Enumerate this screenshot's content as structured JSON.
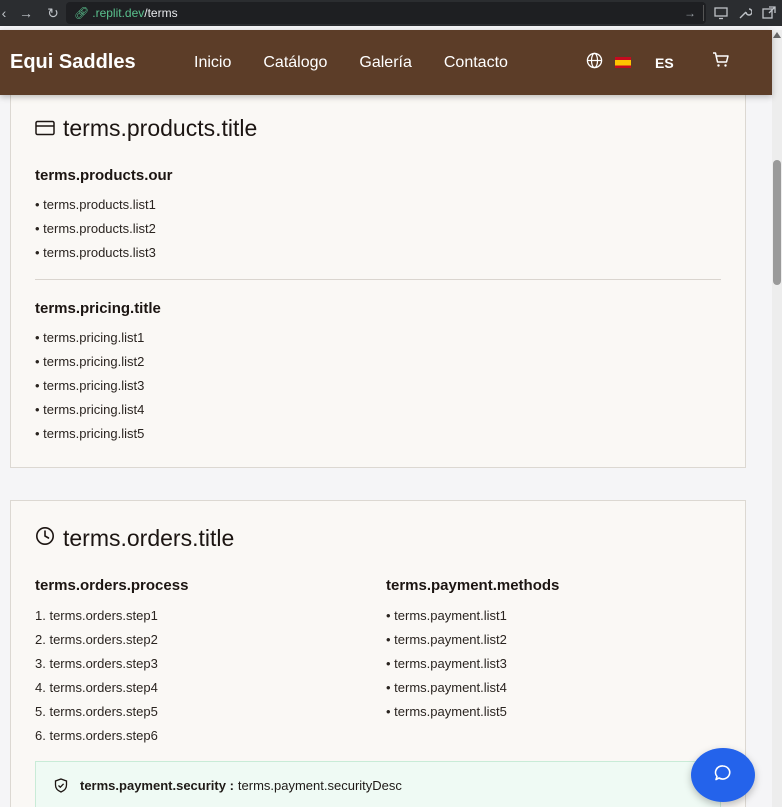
{
  "browser": {
    "url_host": ".replit.dev",
    "url_path": "/terms"
  },
  "header": {
    "brand": "Equi Saddles",
    "nav": [
      "Inicio",
      "Catálogo",
      "Galería",
      "Contacto"
    ],
    "lang_code": "ES",
    "icons": [
      "globe-icon",
      "spain-flag-icon",
      "cart-icon"
    ]
  },
  "products_card": {
    "title": "terms.products.title",
    "icon": "card-icon",
    "products_heading": "terms.products.our",
    "products_list": [
      "terms.products.list1",
      "terms.products.list2",
      "terms.products.list3"
    ],
    "pricing_heading": "terms.pricing.title",
    "pricing_list": [
      "terms.pricing.list1",
      "terms.pricing.list2",
      "terms.pricing.list3",
      "terms.pricing.list4",
      "terms.pricing.list5"
    ]
  },
  "orders_card": {
    "title": "terms.orders.title",
    "icon": "clock-icon",
    "process_heading": "terms.orders.process",
    "steps": [
      "terms.orders.step1",
      "terms.orders.step2",
      "terms.orders.step3",
      "terms.orders.step4",
      "terms.orders.step5",
      "terms.orders.step6"
    ],
    "payment_heading": "terms.payment.methods",
    "payment_list": [
      "terms.payment.list1",
      "terms.payment.list2",
      "terms.payment.list3",
      "terms.payment.list4",
      "terms.payment.list5"
    ],
    "security_label": "terms.payment.security :",
    "security_desc": "terms.payment.securityDesc"
  },
  "colors": {
    "header_bg": "#5c3d28",
    "accent_blue": "#2463eb",
    "card_bg": "#faf8f5",
    "security_bg": "#effaf4"
  }
}
